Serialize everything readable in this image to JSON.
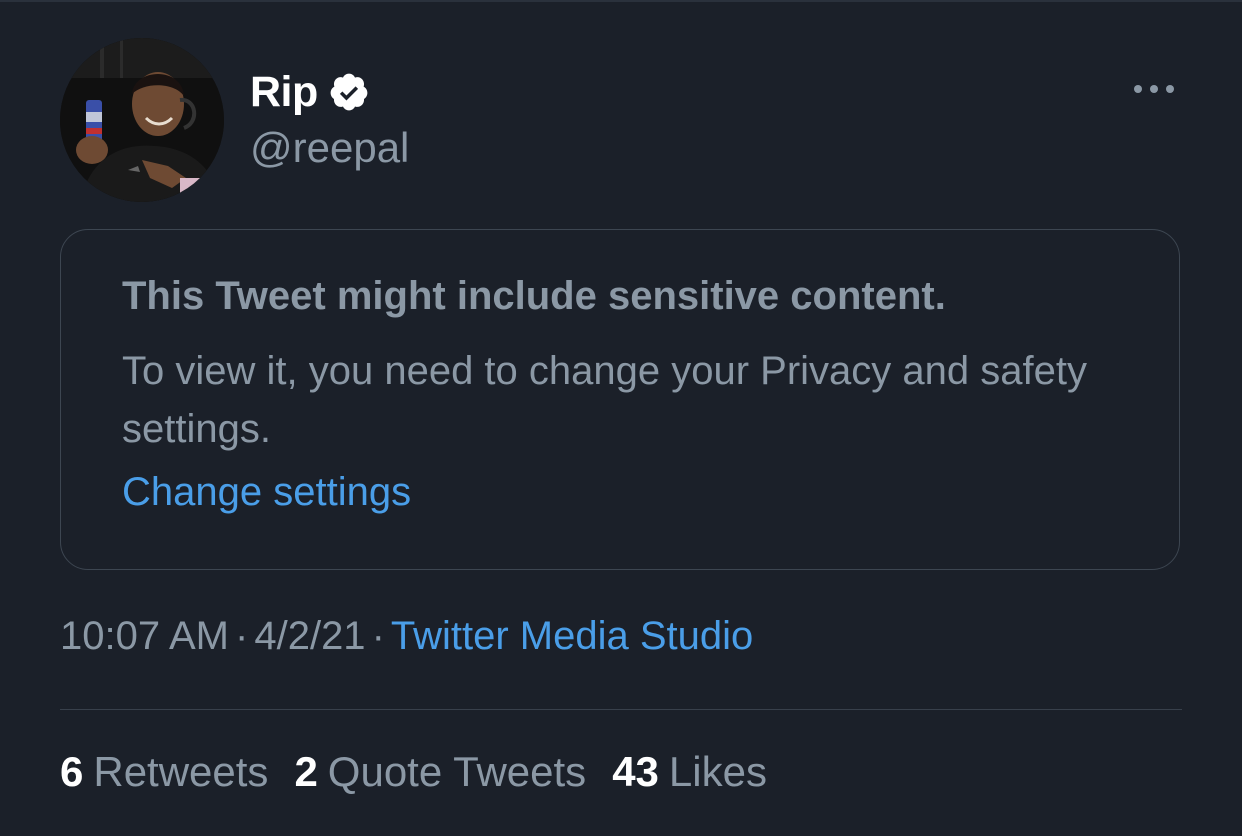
{
  "tweet": {
    "author": {
      "display_name": "Rip",
      "handle": "@reepal",
      "verified": true
    },
    "sensitive_notice": {
      "title": "This Tweet might include sensitive content.",
      "body": "To view it, you need to change your Privacy and safety settings.",
      "link": "Change settings"
    },
    "meta": {
      "time": "10:07 AM",
      "separator": "·",
      "date": "4/2/21",
      "source": "Twitter Media Studio"
    },
    "stats": [
      {
        "count": "6",
        "label": "Retweets"
      },
      {
        "count": "2",
        "label": "Quote Tweets"
      },
      {
        "count": "43",
        "label": "Likes"
      }
    ]
  },
  "icons": {
    "verified": "verified-badge-icon",
    "more": "more-horizontal-icon"
  },
  "colors": {
    "background": "#1b2029",
    "primary_text": "#ffffff",
    "secondary_text": "#8b98a5",
    "link": "#4a9ee8",
    "border": "#3d4651"
  }
}
